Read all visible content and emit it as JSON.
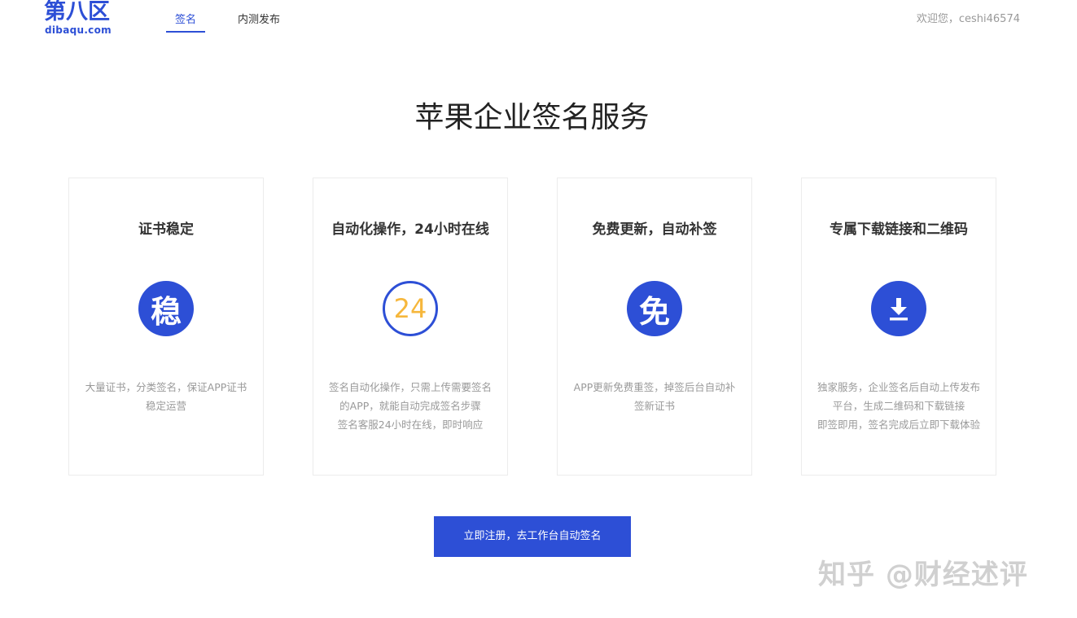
{
  "header": {
    "logo_cn": "第八区",
    "logo_en": "dibaqu.com",
    "nav": [
      {
        "label": "签名",
        "active": true
      },
      {
        "label": "内测发布",
        "active": false
      }
    ],
    "welcome": "欢迎您，ceshi46574"
  },
  "main": {
    "title": "苹果企业签名服务",
    "cards": [
      {
        "title": "证书稳定",
        "icon_glyph": "稳",
        "icon_name": "stable-icon",
        "desc": [
          "大量证书，分类签名，保证APP证书",
          "稳定运营"
        ]
      },
      {
        "title": "自动化操作，24小时在线",
        "icon_glyph": "24",
        "icon_name": "24-hours-icon",
        "desc": [
          "签名自动化操作，只需上传需要签名",
          "的APP，就能自动完成签名步骤",
          "签名客服24小时在线，即时响应"
        ]
      },
      {
        "title": "免费更新，自动补签",
        "icon_glyph": "免",
        "icon_name": "free-icon",
        "desc": [
          "APP更新免费重签，掉签后台自动补",
          "签新证书"
        ]
      },
      {
        "title": "专属下载链接和二维码",
        "icon_name": "download-icon",
        "desc": [
          "独家服务，企业签名后自动上传发布",
          "平台，生成二维码和下载链接",
          "即签即用，签名完成后立即下载体验"
        ]
      }
    ],
    "cta_label": "立即注册，去工作台自动签名"
  },
  "watermark": "知乎 @财经述评",
  "colors": {
    "brand": "#2d4fd6",
    "accent_24": "#f6b73c"
  }
}
